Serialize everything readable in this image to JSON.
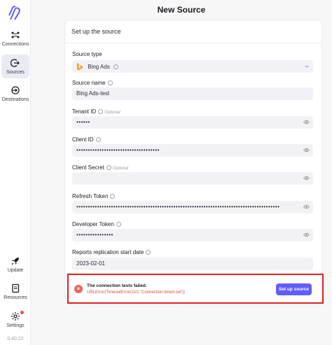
{
  "page": {
    "title": "New Source"
  },
  "sidebar": {
    "items": [
      {
        "label": "Connections",
        "icon": "connections-icon"
      },
      {
        "label": "Sources",
        "icon": "sources-icon",
        "active": true
      },
      {
        "label": "Destinations",
        "icon": "destinations-icon"
      },
      {
        "label": "Update",
        "icon": "rocket-icon"
      },
      {
        "label": "Resources",
        "icon": "book-icon"
      },
      {
        "label": "Settings",
        "icon": "gear-icon"
      }
    ],
    "version": "0.40.22"
  },
  "form": {
    "header": "Set up the source",
    "source_type": {
      "label": "Source type",
      "value": "Bing Ads"
    },
    "source_name": {
      "label": "Source name",
      "value": "Bing Ads-test"
    },
    "tenant_id": {
      "label": "Tenant ID",
      "optional": "Optional",
      "value": "••••••"
    },
    "client_id": {
      "label": "Client ID",
      "value": "••••••••••••••••••••••••••••••••••••"
    },
    "client_secret": {
      "label": "Client Secret",
      "optional": "Optional",
      "value": ""
    },
    "refresh_token": {
      "label": "Refresh Token",
      "value": "••••••••••••••••••••••••••••••••••••••••••••••••••••••••••••••••••••••••••••••••••••••••"
    },
    "developer_token": {
      "label": "Developer Token",
      "value": "••••••••••••••••"
    },
    "reports_start_date": {
      "label": "Reports replication start date",
      "value": "2023-02-01"
    }
  },
  "error": {
    "title": "The connection tests failed.",
    "detail": "URLError(TimeoutError(110, 'Connection timed out'))",
    "button_label": "Set up source"
  },
  "colors": {
    "accent": "#615eff",
    "error": "#e24545",
    "highlight_border": "#e0201f"
  }
}
